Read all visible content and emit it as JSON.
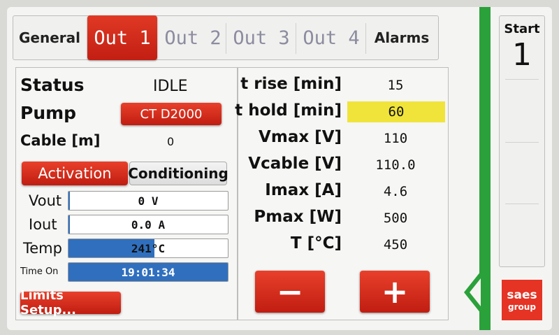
{
  "tabs": [
    {
      "label": "General",
      "active": false
    },
    {
      "label": "Out 1",
      "active": true
    },
    {
      "label": "Out 2",
      "active": false
    },
    {
      "label": "Out 3",
      "active": false
    },
    {
      "label": "Out 4",
      "active": false
    },
    {
      "label": "Alarms",
      "active": false
    }
  ],
  "left": {
    "status_label": "Status",
    "status_value": "IDLE",
    "pump_label": "Pump",
    "pump_value": "CT D2000",
    "cable_label": "Cable [m]",
    "cable_value": "0",
    "activation_button": "Activation",
    "conditioning_button": "Conditioning",
    "readings": [
      {
        "label": "Vout",
        "value": "0 V",
        "fill": 0.01
      },
      {
        "label": "Iout",
        "value": "0.0 A",
        "fill": 0.01
      },
      {
        "label": "Temp",
        "value": "241°C",
        "fill": 0.54
      },
      {
        "label": "Time On",
        "value": "19:01:34",
        "fill": 1.0
      }
    ],
    "limits_button": "Limits Setup..."
  },
  "right": {
    "params": [
      {
        "label": "t rise [min]",
        "value": "15",
        "highlight": false
      },
      {
        "label": "t hold [min]",
        "value": "60",
        "highlight": true
      },
      {
        "label": "Vmax [V]",
        "value": "110",
        "highlight": false
      },
      {
        "label": "Vcable [V]",
        "value": "110.0",
        "highlight": false
      },
      {
        "label": "Imax [A]",
        "value": "4.6",
        "highlight": false
      },
      {
        "label": "Pmax [W]",
        "value": "500",
        "highlight": false
      },
      {
        "label": "T [°C]",
        "value": "450",
        "highlight": false
      }
    ],
    "minus_label": "−",
    "plus_label": "+"
  },
  "side": {
    "start_label": "Start",
    "start_number": "1"
  },
  "logo": {
    "line1": "saes",
    "line2": "group"
  },
  "colors": {
    "accent_red": "#d3281a",
    "bar_blue": "#2f6fbe",
    "highlight_yellow": "#f0e43a",
    "status_green": "#2aa13a"
  }
}
